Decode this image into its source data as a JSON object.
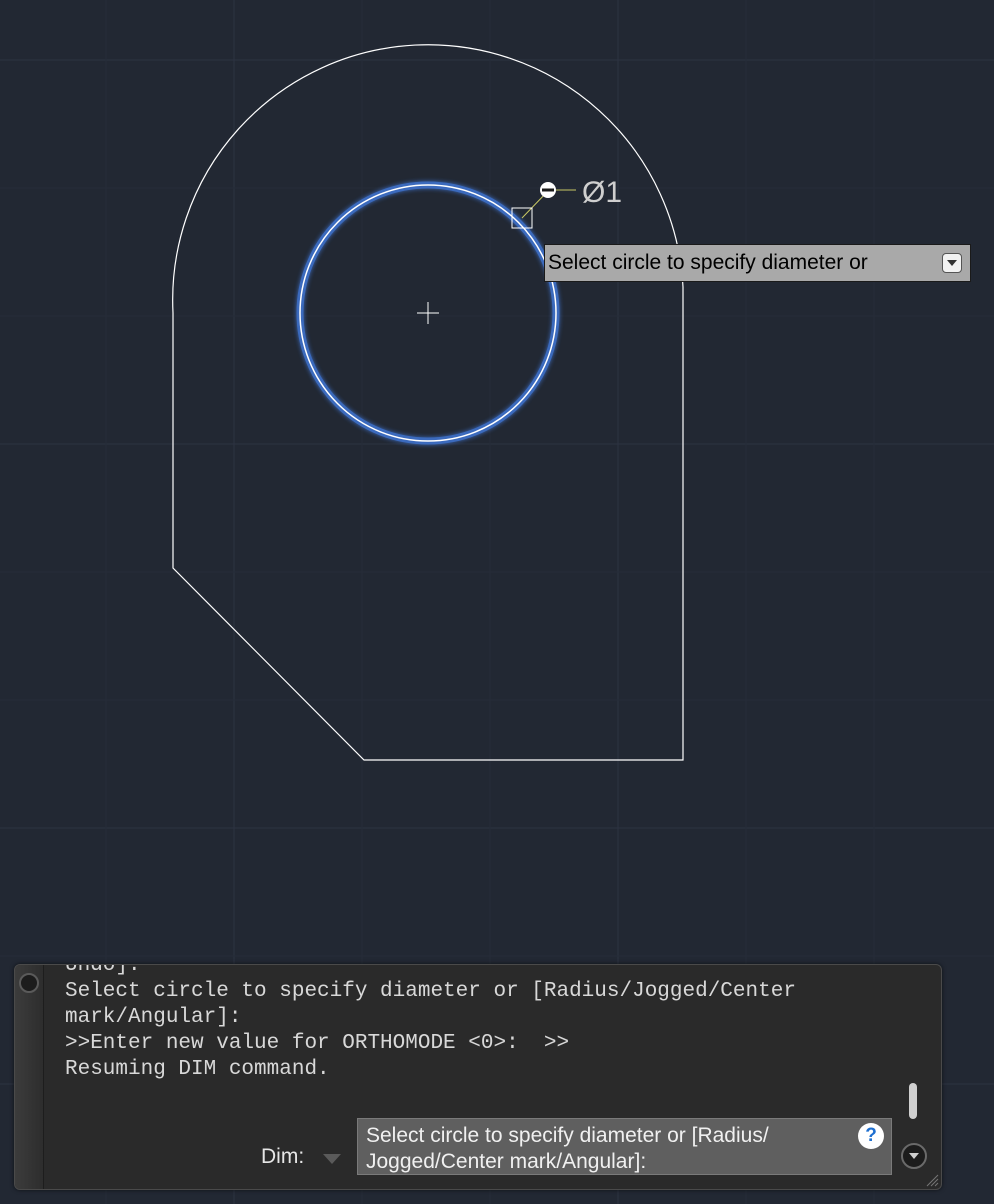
{
  "drawing": {
    "dimension_text": "Ø1"
  },
  "tooltip": {
    "text": "Select circle to specify diameter or",
    "dropdown_icon": "chevron-down-icon"
  },
  "command_line": {
    "history": [
      "Undo]:",
      "Select circle to specify diameter or [Radius/Jogged/Center",
      "mark/Angular]:",
      ">>Enter new value for ORTHOMODE <0>:  >>",
      "Resuming DIM command."
    ],
    "prompt_label": "Dim:",
    "input_text": "Select circle to specify diameter or [Radius/ Jogged/Center mark/Angular]:",
    "help_icon_glyph": "?",
    "colors": {
      "canvas_bg": "#222833",
      "grid": "#2d3442",
      "selection_glow": "#4f86e8",
      "geometry": "#ffffff"
    }
  }
}
